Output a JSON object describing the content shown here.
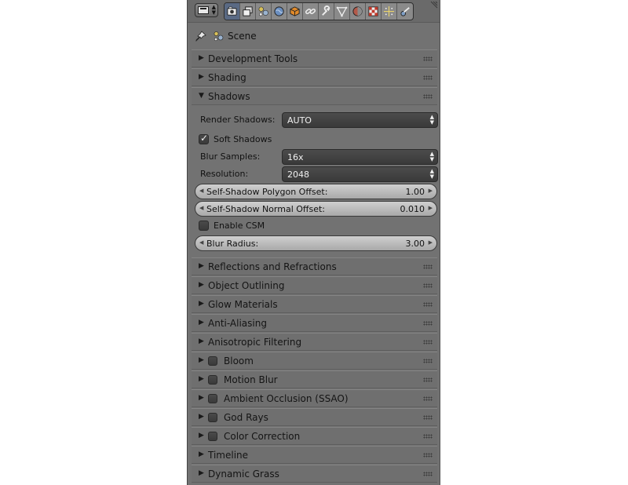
{
  "context": {
    "label": "Scene"
  },
  "toolbar": {
    "tabs": [
      "render-icon",
      "render-layers-icon",
      "scene-icon",
      "world-icon",
      "object-icon",
      "constraints-icon",
      "modifiers-icon",
      "data-icon",
      "material-icon",
      "texture-icon",
      "particles-icon",
      "physics-icon"
    ]
  },
  "sections_top": [
    {
      "label": "Development Tools",
      "expanded": false
    },
    {
      "label": "Shading",
      "expanded": false
    },
    {
      "label": "Shadows",
      "expanded": true
    }
  ],
  "shadows": {
    "render_shadows": {
      "label": "Render Shadows:",
      "value": "AUTO"
    },
    "soft_shadows": {
      "label": "Soft Shadows",
      "checked": true
    },
    "blur_samples": {
      "label": "Blur Samples:",
      "value": "16x"
    },
    "resolution": {
      "label": "Resolution:",
      "value": "2048"
    },
    "polygon_offset": {
      "label": "Self-Shadow Polygon Offset:",
      "value": "1.00"
    },
    "normal_offset": {
      "label": "Self-Shadow Normal Offset:",
      "value": "0.010"
    },
    "enable_csm": {
      "label": "Enable CSM",
      "checked": false
    },
    "blur_radius": {
      "label": "Blur Radius:",
      "value": "3.00"
    }
  },
  "sections_bottom": [
    {
      "label": "Reflections and Refractions",
      "checkbox": false
    },
    {
      "label": "Object Outlining",
      "checkbox": false
    },
    {
      "label": "Glow Materials",
      "checkbox": false
    },
    {
      "label": "Anti-Aliasing",
      "checkbox": false
    },
    {
      "label": "Anisotropic Filtering",
      "checkbox": false
    },
    {
      "label": "Bloom",
      "checkbox": true
    },
    {
      "label": "Motion Blur",
      "checkbox": true
    },
    {
      "label": "Ambient Occlusion (SSAO)",
      "checkbox": true
    },
    {
      "label": "God Rays",
      "checkbox": true
    },
    {
      "label": "Color Correction",
      "checkbox": true
    },
    {
      "label": "Timeline",
      "checkbox": false
    },
    {
      "label": "Dynamic Grass",
      "checkbox": false
    }
  ]
}
